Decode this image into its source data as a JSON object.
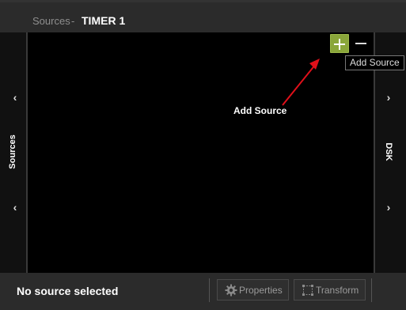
{
  "header": {
    "breadcrumb_section": "Sources",
    "breadcrumb_separator": "-",
    "breadcrumb_title": "TIMER 1"
  },
  "left_panel": {
    "label": "Sources",
    "chevron_top": "‹",
    "chevron_bottom": "‹"
  },
  "right_panel": {
    "label": "DSK",
    "chevron_top": "›",
    "chevron_bottom": "›"
  },
  "canvas": {
    "add_button_icon": "plus-icon",
    "add_button_color": "#8aa63a",
    "remove_button_icon": "minus-icon",
    "tooltip": "Add Source",
    "annotation_text": "Add Source",
    "annotation_arrow_color": "#e0101a"
  },
  "footer": {
    "status": "No source selected",
    "properties_label": "Properties",
    "properties_icon": "gear-icon",
    "transform_label": "Transform",
    "transform_icon": "transform-frame-icon"
  }
}
